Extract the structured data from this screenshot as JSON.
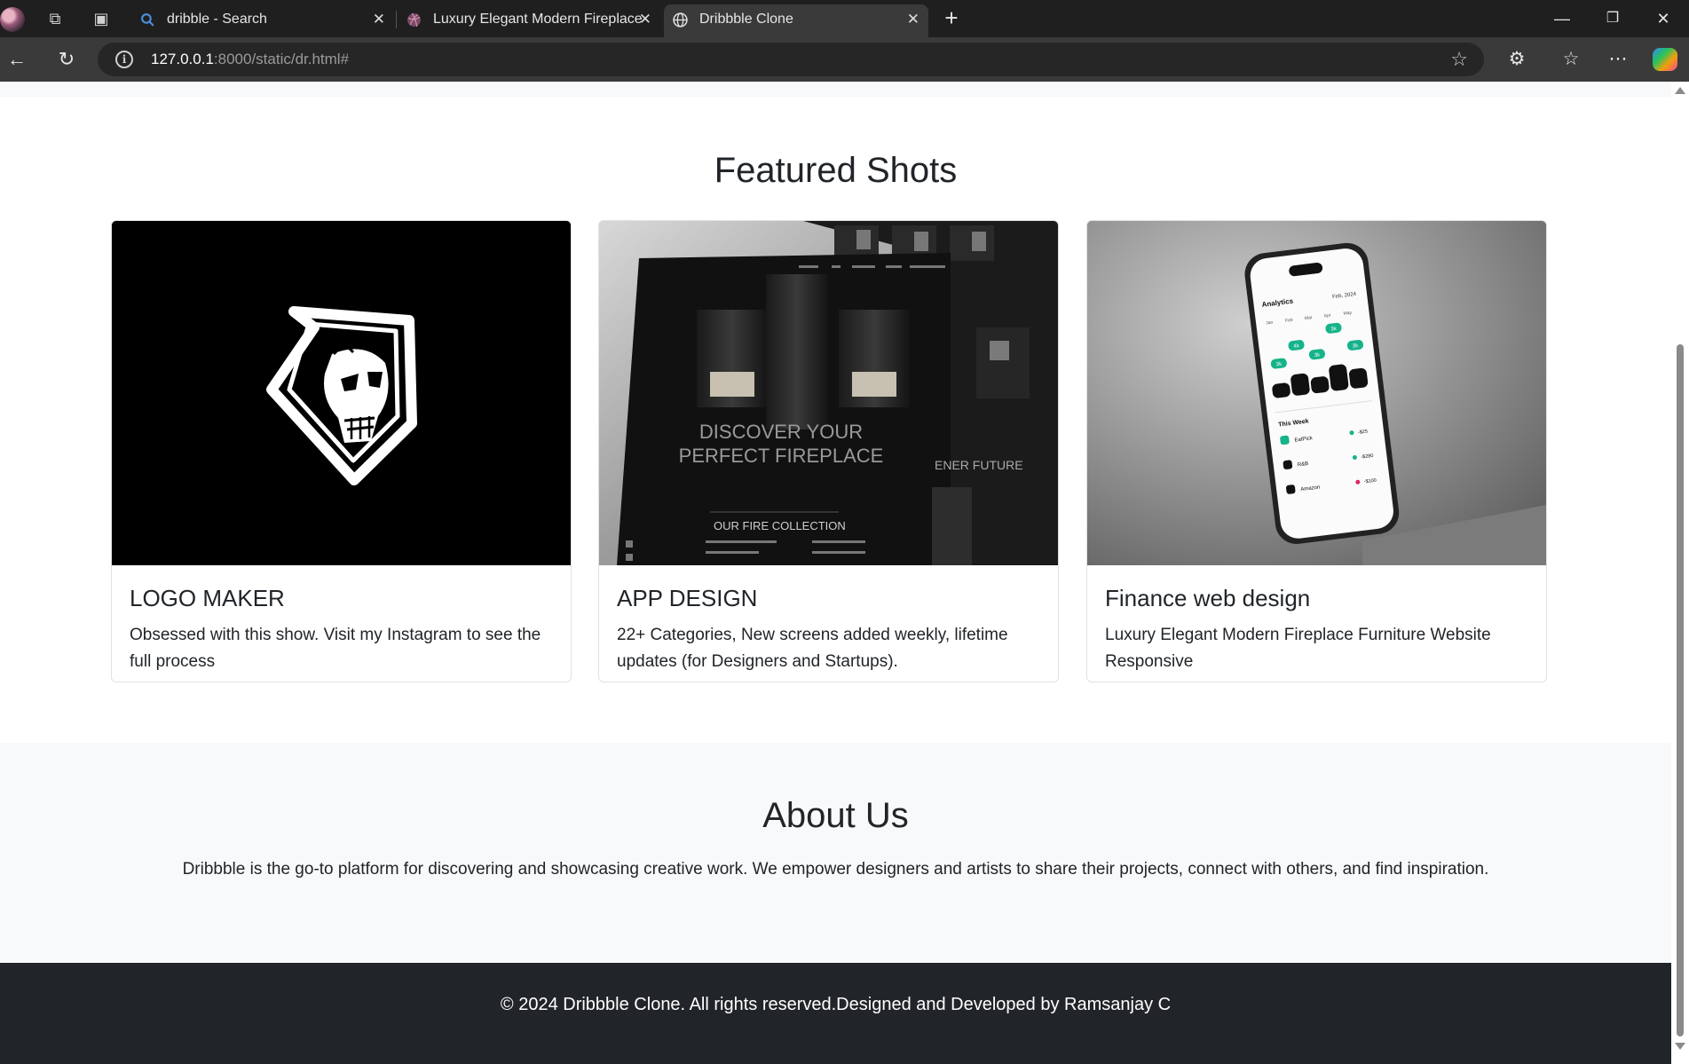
{
  "browser": {
    "tabs": [
      {
        "title": "dribble - Search",
        "active": false
      },
      {
        "title": "Luxury Elegant Modern Fireplace",
        "active": false
      },
      {
        "title": "Dribbble Clone",
        "active": true
      }
    ],
    "new_tab_label": "+",
    "url_host": "127.0.0.1",
    "url_rest": ":8000/static/dr.html#",
    "icons": [
      "back-icon",
      "refresh-icon",
      "info-icon",
      "star-icon",
      "extensions-icon",
      "favorites-icon",
      "more-icon",
      "copilot-icon",
      "minimize-icon",
      "restore-icon",
      "close-icon"
    ]
  },
  "featured": {
    "title": "Featured Shots",
    "cards": [
      {
        "title": "LOGO MAKER",
        "text": "Obsessed with this show. Visit my Instagram to see the full process"
      },
      {
        "title": "APP DESIGN",
        "text": "22+ Categories, New screens added weekly, lifetime updates (for Designers and Startups)."
      },
      {
        "title": "Finance web design",
        "text": "Luxury Elegant Modern Fireplace Furniture Website Responsive"
      }
    ],
    "fireplace_image": {
      "headline_1": "DISCOVER YOUR",
      "headline_2": "PERFECT FIREPLACE",
      "collection": "OUR FIRE COLLECTION",
      "side_text": "ENER FUTURE"
    },
    "phone_image": {
      "heading": "Analytics",
      "date": "Feb, 2024",
      "months": [
        "Jan",
        "Feb",
        "Mar",
        "Apr",
        "May"
      ],
      "bubbles": [
        "3k",
        "4k",
        "3k",
        "3k",
        "3k"
      ],
      "week_label": "This Week",
      "transactions": [
        {
          "name": "EatPick",
          "amount": "-$25"
        },
        {
          "name": "R&B",
          "amount": "-$280"
        },
        {
          "name": "Amazon",
          "amount": "-$100"
        }
      ]
    }
  },
  "about": {
    "title": "About Us",
    "text": "Dribbble is the go-to platform for discovering and showcasing creative work. We empower designers and artists to share their projects, connect with others, and find inspiration."
  },
  "footer": {
    "text": "© 2024 Dribbble Clone. All rights reserved.Designed and Developed by Ramsanjay C"
  },
  "colors": {
    "tabbar": "#1f1f1f",
    "toolbar": "#3a3a3a",
    "page_bg": "#ffffff",
    "section_bg": "#f8f9fa",
    "footer_bg": "#212529",
    "text": "#212529",
    "accent_green": "#16b38a"
  }
}
